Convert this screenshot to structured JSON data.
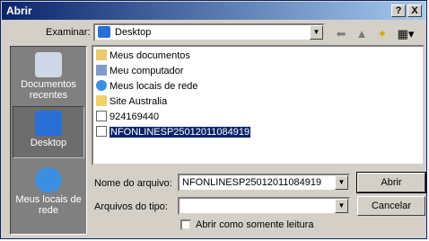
{
  "title": "Abrir",
  "titlebar": {
    "help": "?",
    "close": "X"
  },
  "look_in": {
    "label": "Examinar:",
    "value": "Desktop"
  },
  "places": [
    {
      "label": "Documentos recentes",
      "icon": "recent-documents-icon"
    },
    {
      "label": "Desktop",
      "icon": "desktop-icon"
    },
    {
      "label": "Meus locais de rede",
      "icon": "network-places-icon"
    }
  ],
  "files": [
    {
      "name": "Meus documentos",
      "icon": "folder-documents-icon"
    },
    {
      "name": "Meu computador",
      "icon": "computer-icon"
    },
    {
      "name": "Meus locais de rede",
      "icon": "network-icon"
    },
    {
      "name": "Site Australia",
      "icon": "folder-icon"
    },
    {
      "name": "924169440",
      "icon": "document-icon"
    },
    {
      "name": "NFONLINESP25012011084919",
      "icon": "document-icon"
    }
  ],
  "filename": {
    "label": "Nome do arquivo:",
    "value": "NFONLINESP25012011084919"
  },
  "filetype": {
    "label": "Arquivos do tipo:",
    "value": ""
  },
  "readonly": {
    "label": "Abrir como somente leitura"
  },
  "buttons": {
    "open": "Abrir",
    "cancel": "Cancelar"
  }
}
